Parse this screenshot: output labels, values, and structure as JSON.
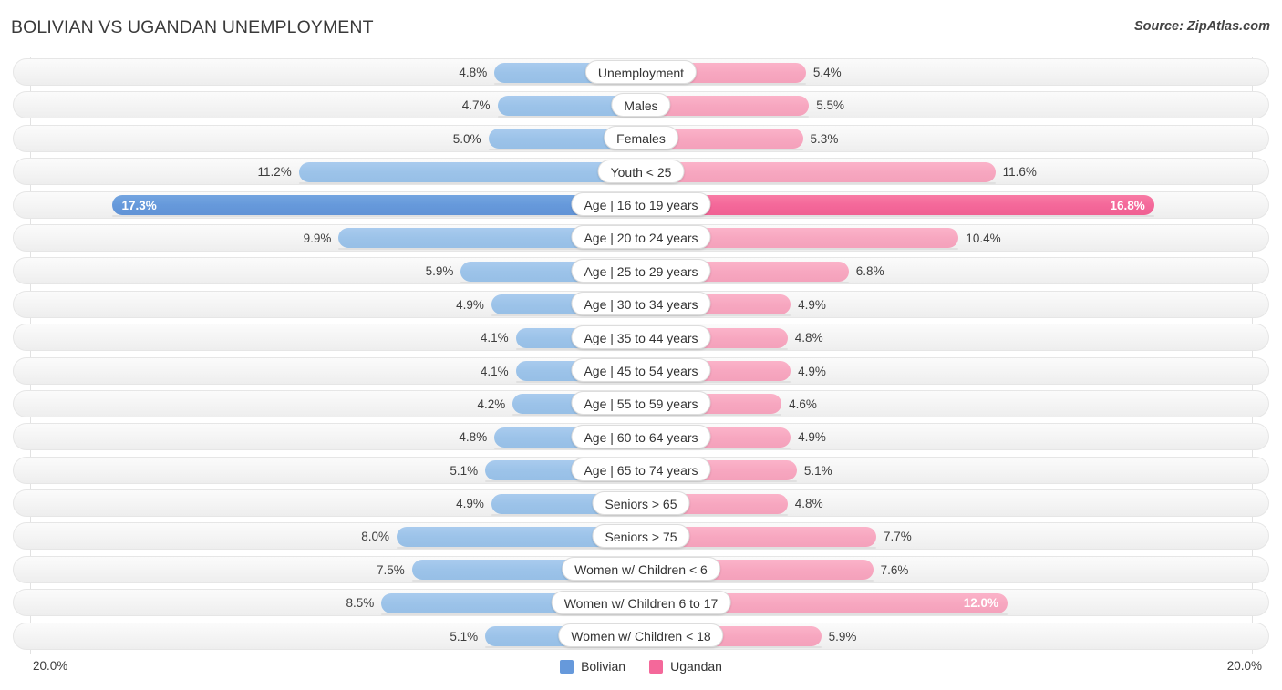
{
  "header": {
    "title": "BOLIVIAN VS UGANDAN UNEMPLOYMENT",
    "source": "Source: ZipAtlas.com"
  },
  "legend": {
    "items": [
      {
        "label": "Bolivian",
        "color": "#6699db"
      },
      {
        "label": "Ugandan",
        "color": "#f4689a"
      }
    ]
  },
  "axis": {
    "left_max_label": "20.0%",
    "right_max_label": "20.0%",
    "max": 20.0
  },
  "colors": {
    "bolivian_light": "#9cc3e9",
    "bolivian_dark": "#6699db",
    "ugandan_light": "#f7a7c0",
    "ugandan_dark": "#f4689a",
    "track": "#f4f4f4",
    "pill_bg": "#ffffff"
  },
  "chart_data": {
    "type": "bar",
    "title": "BOLIVIAN VS UGANDAN UNEMPLOYMENT",
    "subtitle": "Source: ZipAtlas.com",
    "orientation": "horizontal-diverging",
    "xlabel": "",
    "ylabel": "",
    "xlim": [
      20.0,
      20.0
    ],
    "grid": false,
    "legend_position": "bottom-center",
    "categories": [
      "Unemployment",
      "Males",
      "Females",
      "Youth < 25",
      "Age | 16 to 19 years",
      "Age | 20 to 24 years",
      "Age | 25 to 29 years",
      "Age | 30 to 34 years",
      "Age | 35 to 44 years",
      "Age | 45 to 54 years",
      "Age | 55 to 59 years",
      "Age | 60 to 64 years",
      "Age | 65 to 74 years",
      "Seniors > 65",
      "Seniors > 75",
      "Women w/ Children < 6",
      "Women w/ Children 6 to 17",
      "Women w/ Children < 18"
    ],
    "series": [
      {
        "name": "Bolivian",
        "color": "#6699db",
        "values": [
          4.8,
          4.7,
          5.0,
          11.2,
          17.3,
          9.9,
          5.9,
          4.9,
          4.1,
          4.1,
          4.2,
          4.8,
          5.1,
          4.9,
          8.0,
          7.5,
          8.5,
          5.1
        ],
        "labels": [
          "4.8%",
          "4.7%",
          "5.0%",
          "11.2%",
          "17.3%",
          "9.9%",
          "5.9%",
          "4.9%",
          "4.1%",
          "4.1%",
          "4.2%",
          "4.8%",
          "5.1%",
          "4.9%",
          "8.0%",
          "7.5%",
          "8.5%",
          "5.1%"
        ]
      },
      {
        "name": "Ugandan",
        "color": "#f4689a",
        "values": [
          5.4,
          5.5,
          5.3,
          11.6,
          16.8,
          10.4,
          6.8,
          4.9,
          4.8,
          4.9,
          4.6,
          4.9,
          5.1,
          4.8,
          7.7,
          7.6,
          12.0,
          5.9
        ],
        "labels": [
          "5.4%",
          "5.5%",
          "5.3%",
          "11.6%",
          "16.8%",
          "10.4%",
          "6.8%",
          "4.9%",
          "4.8%",
          "4.9%",
          "4.6%",
          "4.9%",
          "5.1%",
          "4.8%",
          "7.7%",
          "7.6%",
          "12.0%",
          "5.9%"
        ]
      }
    ]
  },
  "rows": [
    {
      "label": "Unemployment",
      "left_value": 4.8,
      "left_label": "4.8%",
      "right_value": 5.4,
      "right_label": "5.4%",
      "highlight": false
    },
    {
      "label": "Males",
      "left_value": 4.7,
      "left_label": "4.7%",
      "right_value": 5.5,
      "right_label": "5.5%",
      "highlight": false
    },
    {
      "label": "Females",
      "left_value": 5.0,
      "left_label": "5.0%",
      "right_value": 5.3,
      "right_label": "5.3%",
      "highlight": false
    },
    {
      "label": "Youth < 25",
      "left_value": 11.2,
      "left_label": "11.2%",
      "right_value": 11.6,
      "right_label": "11.6%",
      "highlight": false
    },
    {
      "label": "Age | 16 to 19 years",
      "left_value": 17.3,
      "left_label": "17.3%",
      "right_value": 16.8,
      "right_label": "16.8%",
      "highlight": true
    },
    {
      "label": "Age | 20 to 24 years",
      "left_value": 9.9,
      "left_label": "9.9%",
      "right_value": 10.4,
      "right_label": "10.4%",
      "highlight": false
    },
    {
      "label": "Age | 25 to 29 years",
      "left_value": 5.9,
      "left_label": "5.9%",
      "right_value": 6.8,
      "right_label": "6.8%",
      "highlight": false
    },
    {
      "label": "Age | 30 to 34 years",
      "left_value": 4.9,
      "left_label": "4.9%",
      "right_value": 4.9,
      "right_label": "4.9%",
      "highlight": false
    },
    {
      "label": "Age | 35 to 44 years",
      "left_value": 4.1,
      "left_label": "4.1%",
      "right_value": 4.8,
      "right_label": "4.8%",
      "highlight": false
    },
    {
      "label": "Age | 45 to 54 years",
      "left_value": 4.1,
      "left_label": "4.1%",
      "right_value": 4.9,
      "right_label": "4.9%",
      "highlight": false
    },
    {
      "label": "Age | 55 to 59 years",
      "left_value": 4.2,
      "left_label": "4.2%",
      "right_value": 4.6,
      "right_label": "4.6%",
      "highlight": false
    },
    {
      "label": "Age | 60 to 64 years",
      "left_value": 4.8,
      "left_label": "4.8%",
      "right_value": 4.9,
      "right_label": "4.9%",
      "highlight": false
    },
    {
      "label": "Age | 65 to 74 years",
      "left_value": 5.1,
      "left_label": "5.1%",
      "right_value": 5.1,
      "right_label": "5.1%",
      "highlight": false
    },
    {
      "label": "Seniors > 65",
      "left_value": 4.9,
      "left_label": "4.9%",
      "right_value": 4.8,
      "right_label": "4.8%",
      "highlight": false
    },
    {
      "label": "Seniors > 75",
      "left_value": 8.0,
      "left_label": "8.0%",
      "right_value": 7.7,
      "right_label": "7.7%",
      "highlight": false
    },
    {
      "label": "Women w/ Children < 6",
      "left_value": 7.5,
      "left_label": "7.5%",
      "right_value": 7.6,
      "right_label": "7.6%",
      "highlight": false
    },
    {
      "label": "Women w/ Children 6 to 17",
      "left_value": 8.5,
      "left_label": "8.5%",
      "right_value": 12.0,
      "right_label": "12.0%",
      "highlight": false,
      "right_inside": true
    },
    {
      "label": "Women w/ Children < 18",
      "left_value": 5.1,
      "left_label": "5.1%",
      "right_value": 5.9,
      "right_label": "5.9%",
      "highlight": false
    }
  ]
}
